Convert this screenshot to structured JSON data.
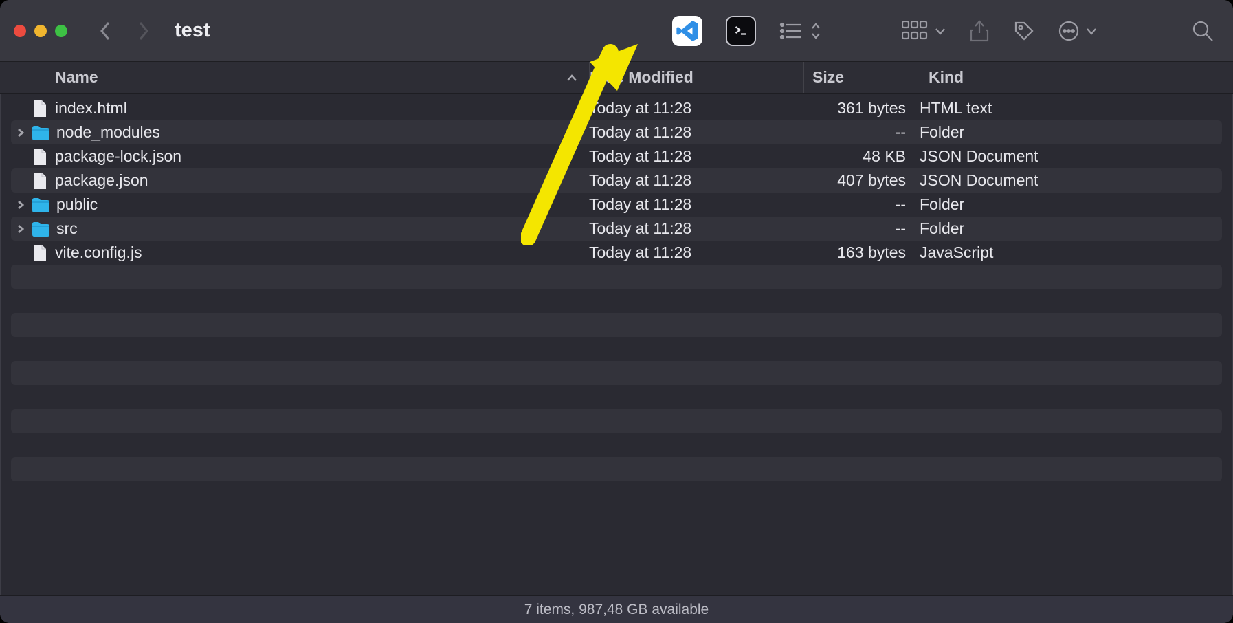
{
  "window": {
    "title": "test"
  },
  "columns": {
    "name": "Name",
    "date": "Date Modified",
    "size": "Size",
    "kind": "Kind"
  },
  "rows": [
    {
      "expandable": false,
      "icon": "file",
      "name": "index.html",
      "date": "Today at 11:28",
      "size": "361 bytes",
      "kind": "HTML text"
    },
    {
      "expandable": true,
      "icon": "folder",
      "name": "node_modules",
      "date": "Today at 11:28",
      "size": "--",
      "kind": "Folder"
    },
    {
      "expandable": false,
      "icon": "file",
      "name": "package-lock.json",
      "date": "Today at 11:28",
      "size": "48 KB",
      "kind": "JSON Document"
    },
    {
      "expandable": false,
      "icon": "file",
      "name": "package.json",
      "date": "Today at 11:28",
      "size": "407 bytes",
      "kind": "JSON Document"
    },
    {
      "expandable": true,
      "icon": "folder",
      "name": "public",
      "date": "Today at 11:28",
      "size": "--",
      "kind": "Folder"
    },
    {
      "expandable": true,
      "icon": "folder",
      "name": "src",
      "date": "Today at 11:28",
      "size": "--",
      "kind": "Folder"
    },
    {
      "expandable": false,
      "icon": "file",
      "name": "vite.config.js",
      "date": "Today at 11:28",
      "size": "163 bytes",
      "kind": "JavaScript"
    }
  ],
  "empty_stripe_rows": 10,
  "status": "7 items, 987,48 GB available",
  "toolbar_icons": {
    "vscode": "vscode-icon",
    "terminal": "terminal-icon",
    "list": "list-view-icon",
    "group": "group-by-icon",
    "share": "share-icon",
    "tag": "tag-icon",
    "more": "more-icon",
    "search": "search-icon"
  },
  "annotation": {
    "target": "terminal-icon"
  }
}
